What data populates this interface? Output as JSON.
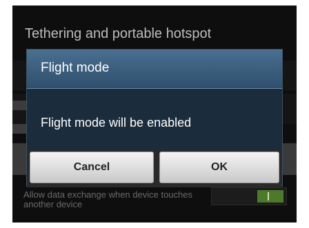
{
  "background": {
    "title": "Tethering and portable hotspot",
    "description": "Allow data exchange when device touches another device"
  },
  "dialog": {
    "title": "Flight mode",
    "message": "Flight mode will be enabled",
    "cancel_label": "Cancel",
    "ok_label": "OK"
  },
  "colors": {
    "dialog_header": "#3f5f7e",
    "dialog_body": "#1b2c3c",
    "toggle_on": "#4d7a2a"
  }
}
